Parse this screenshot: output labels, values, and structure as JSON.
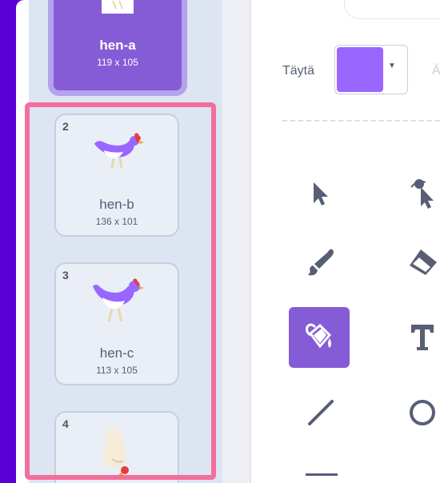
{
  "costumes": [
    {
      "number": "",
      "name": "hen-a",
      "dims": "119 x 105",
      "selected": true
    },
    {
      "number": "2",
      "name": "hen-b",
      "dims": "136 x 101"
    },
    {
      "number": "3",
      "name": "hen-c",
      "dims": "113 x 105"
    },
    {
      "number": "4",
      "name": "",
      "dims": ""
    }
  ],
  "toolbar": {
    "fill_label": "Täytä",
    "fill_color": "#9966ff",
    "next_label": "Ää"
  },
  "tools": [
    "select-tool",
    "reshape-tool",
    "brush-tool",
    "eraser-tool",
    "fill-tool",
    "text-tool",
    "line-tool",
    "circle-tool"
  ],
  "colors": {
    "accent": "#855cd6",
    "highlight": "#f26f9b",
    "background": "#5a00d6"
  }
}
